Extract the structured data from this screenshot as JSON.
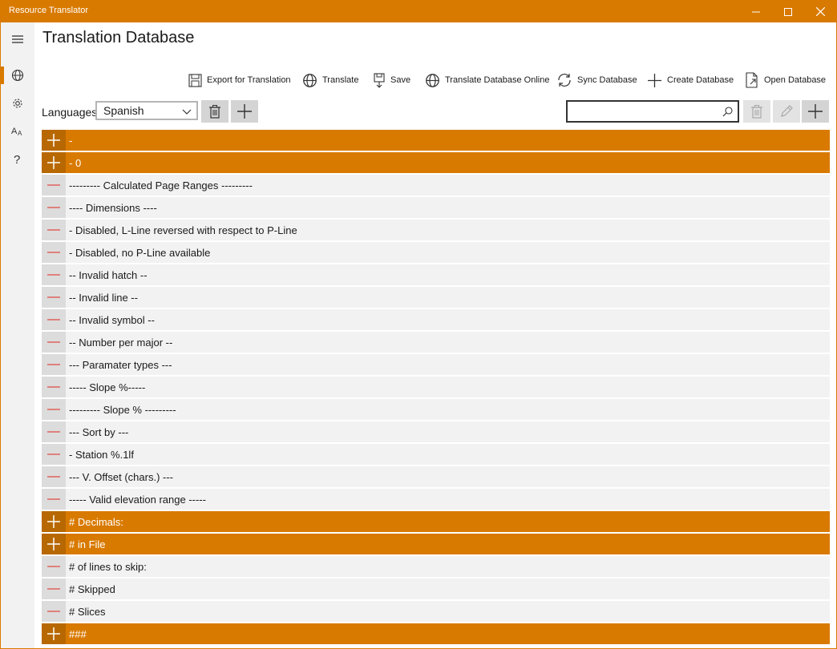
{
  "window": {
    "title": "Resource Translator"
  },
  "page": {
    "title": "Translation Database"
  },
  "sidebar": {
    "items": [
      {
        "icon": "hamburger-icon"
      },
      {
        "icon": "globe-icon",
        "active": true
      },
      {
        "icon": "gear-icon"
      },
      {
        "icon": "font-size-icon"
      },
      {
        "icon": "help-icon"
      }
    ]
  },
  "toolbar": {
    "export_label": "Export for Translation",
    "translate_label": "Translate",
    "save_label": "Save",
    "translate_online_label": "Translate Database Online",
    "sync_label": "Sync Database",
    "create_label": "Create Database",
    "open_label": "Open Database"
  },
  "languages": {
    "label": "Languages",
    "selected": "Spanish"
  },
  "search": {
    "value": ""
  },
  "rows": [
    {
      "type": "group",
      "text": "-"
    },
    {
      "type": "group",
      "text": "- 0"
    },
    {
      "type": "item",
      "text": "--------- Calculated Page Ranges ---------"
    },
    {
      "type": "item",
      "text": "---- Dimensions ----"
    },
    {
      "type": "item",
      "text": "- Disabled, L-Line reversed with respect to P-Line"
    },
    {
      "type": "item",
      "text": "- Disabled, no P-Line available"
    },
    {
      "type": "item",
      "text": "-- Invalid hatch --"
    },
    {
      "type": "item",
      "text": "-- Invalid line --"
    },
    {
      "type": "item",
      "text": "-- Invalid symbol --"
    },
    {
      "type": "item",
      "text": "-- Number per major --"
    },
    {
      "type": "item",
      "text": "--- Paramater types ---"
    },
    {
      "type": "item",
      "text": "----- Slope %-----"
    },
    {
      "type": "item",
      "text": "--------- Slope % ---------"
    },
    {
      "type": "item",
      "text": "--- Sort by ---"
    },
    {
      "type": "item",
      "text": "- Station %.1lf"
    },
    {
      "type": "item",
      "text": "--- V. Offset (chars.) ---"
    },
    {
      "type": "item",
      "text": "----- Valid elevation range -----"
    },
    {
      "type": "group",
      "text": "# Decimals:"
    },
    {
      "type": "group",
      "text": "# in File"
    },
    {
      "type": "item",
      "text": "# of lines to skip:"
    },
    {
      "type": "item",
      "text": "# Skipped"
    },
    {
      "type": "item",
      "text": "# Slices"
    },
    {
      "type": "group",
      "text": "###"
    }
  ],
  "colors": {
    "accent": "#d97a00",
    "minus": "#e0504a"
  }
}
